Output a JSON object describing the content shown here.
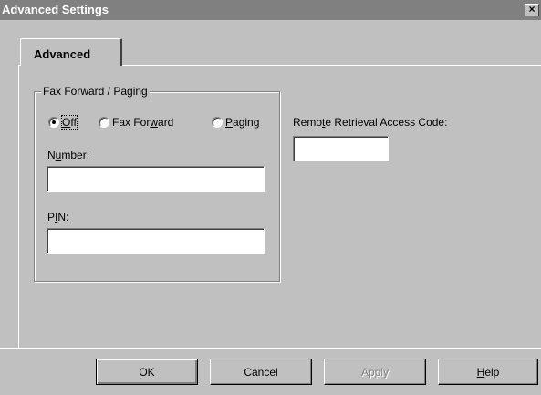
{
  "window": {
    "title": "Advanced Settings",
    "close_glyph": "×"
  },
  "tabs": [
    {
      "label": "Advanced"
    }
  ],
  "fax_group": {
    "legend": "Fax Forward / Paging",
    "radios": [
      {
        "label_pre": "",
        "label_mnemonic": "O",
        "label_post": "ff",
        "checked": true
      },
      {
        "label_pre": "Fax For",
        "label_mnemonic": "w",
        "label_post": "ard",
        "checked": false
      },
      {
        "label_pre": "",
        "label_mnemonic": "P",
        "label_post": "aging",
        "checked": false
      }
    ],
    "number": {
      "label_pre": "N",
      "label_mnemonic": "u",
      "label_post": "mber:",
      "value": ""
    },
    "pin": {
      "label_pre": "P",
      "label_mnemonic": "I",
      "label_post": "N:",
      "value": ""
    }
  },
  "remote": {
    "label_pre": "Remo",
    "label_mnemonic": "t",
    "label_post": "e Retrieval Access Code:",
    "value": ""
  },
  "buttons": {
    "ok": "OK",
    "cancel": "Cancel",
    "apply": "Apply",
    "help_mnemonic": "H",
    "help_post": "elp"
  }
}
